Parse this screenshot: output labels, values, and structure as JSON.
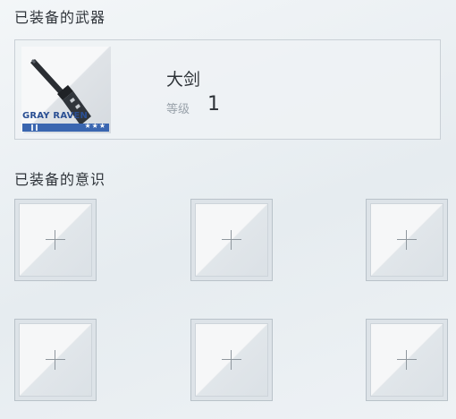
{
  "equipped_weapon": {
    "section_title": "已装备的武器",
    "name": "大剑",
    "level_label": "等级",
    "level": "1",
    "brand": "GRAY RAVEN",
    "rarity_stars": "★★★",
    "icon": "greatsword-icon"
  },
  "equipped_memories": {
    "section_title": "已装备的意识",
    "slots": [
      {
        "state": "empty",
        "icon": "plus-icon"
      },
      {
        "state": "empty",
        "icon": "plus-icon"
      },
      {
        "state": "empty",
        "icon": "plus-icon"
      },
      {
        "state": "empty",
        "icon": "plus-icon"
      },
      {
        "state": "empty",
        "icon": "plus-icon"
      },
      {
        "state": "empty",
        "icon": "plus-icon"
      }
    ]
  },
  "colors": {
    "brand_blue": "#3a66b0",
    "brand_text": "#2a4f93",
    "background": "#eaeff2"
  }
}
